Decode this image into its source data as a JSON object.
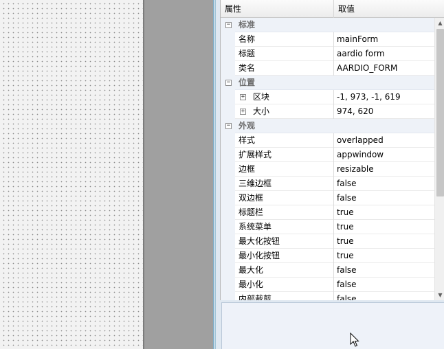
{
  "property_grid": {
    "header": {
      "name_col": "属性",
      "value_col": "取值"
    },
    "categories": [
      {
        "label": "标准",
        "toggle": "−",
        "rows": [
          {
            "name": "名称",
            "value": "mainForm"
          },
          {
            "name": "标题",
            "value": "aardio form"
          },
          {
            "name": "类名",
            "value": "AARDIO_FORM"
          }
        ]
      },
      {
        "label": "位置",
        "toggle": "−",
        "rows": [
          {
            "name": "区块",
            "value": "-1, 973, -1, 619",
            "expand": "+"
          },
          {
            "name": "大小",
            "value": "974, 620",
            "expand": "+"
          }
        ]
      },
      {
        "label": "外观",
        "toggle": "−",
        "rows": [
          {
            "name": "样式",
            "value": "overlapped"
          },
          {
            "name": "扩展样式",
            "value": "appwindow"
          },
          {
            "name": "边框",
            "value": "resizable"
          },
          {
            "name": "三维边框",
            "value": "false"
          },
          {
            "name": "双边框",
            "value": "false"
          },
          {
            "name": "标题栏",
            "value": "true"
          },
          {
            "name": "系统菜单",
            "value": "true"
          },
          {
            "name": "最大化按钮",
            "value": "true"
          },
          {
            "name": "最小化按钮",
            "value": "true"
          },
          {
            "name": "最大化",
            "value": "false"
          },
          {
            "name": "最小化",
            "value": "false"
          },
          {
            "name": "内部裁剪",
            "value": "false"
          }
        ]
      }
    ],
    "scrollbar": {
      "up_glyph": "▲",
      "down_glyph": "▼"
    }
  },
  "description": {
    "title": "",
    "text": ""
  }
}
